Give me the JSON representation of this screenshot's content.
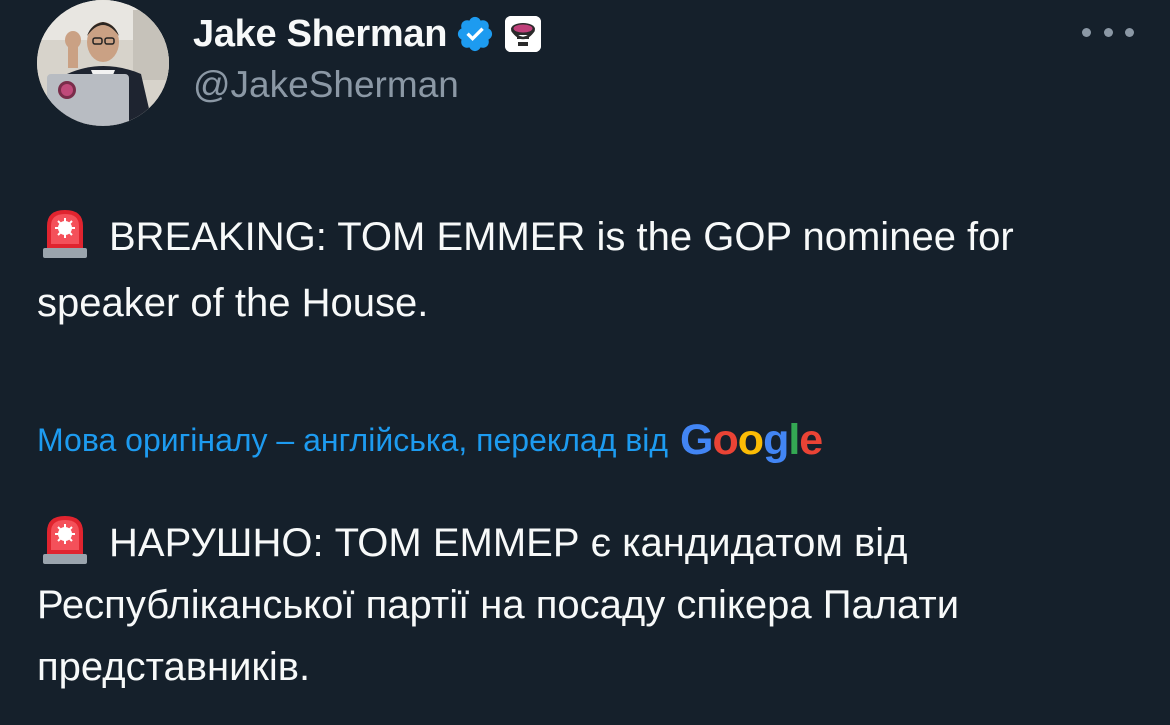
{
  "author": {
    "display_name": "Jake Sherman",
    "handle": "@JakeSherman",
    "verified_icon": "verified-badge-icon",
    "affiliate_icon": "punchbowl-affiliate-icon"
  },
  "actions": {
    "more_icon": "more-horizontal-icon"
  },
  "tweet": {
    "emoji": "rotating-light-emoji",
    "text": "BREAKING: TOM EMMER is the GOP nominee for speaker of the House."
  },
  "translation": {
    "notice": "Мова оригіналу – англійська, переклад від",
    "provider_logo": {
      "letters": [
        "G",
        "o",
        "o",
        "g",
        "l",
        "e"
      ],
      "colors": [
        "#4285f4",
        "#ea4335",
        "#fbbc05",
        "#4285f4",
        "#34a853",
        "#ea4335"
      ]
    },
    "translated_text": "НАРУШНО: ТОМ ЕММЕР є кандидатом від Республіканської партії на посаду спікера Палати представників."
  },
  "colors": {
    "background": "#15202b",
    "text_primary": "#f7f9f9",
    "text_secondary": "#8b98a5",
    "accent": "#1d9bf0"
  }
}
